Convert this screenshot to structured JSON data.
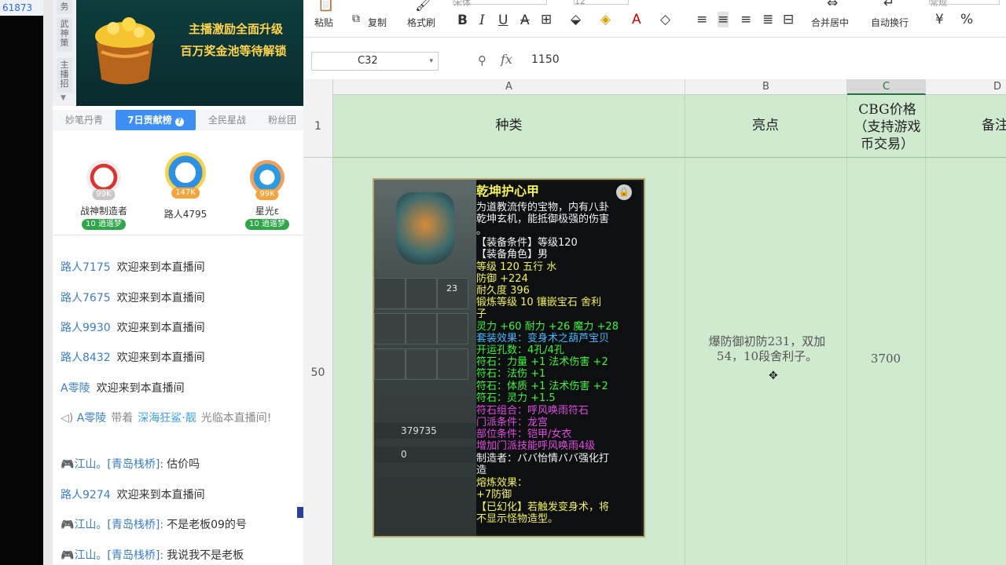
{
  "stream": {
    "user_id_tag": "61873",
    "side_tabs": [
      "务",
      "武神策",
      "主播招"
    ],
    "banner_line1": "主播激励全面升级",
    "banner_line2": "百万奖金池等待解锁",
    "tabs": [
      "妙笔丹青",
      "7日贡献榜",
      "全民星战",
      "粉丝团"
    ],
    "ranks": [
      {
        "name": "战神制造者",
        "score": "99K",
        "level": "10",
        "badge": "逍遥梦"
      },
      {
        "name": "路人4795",
        "score": "147K"
      },
      {
        "name": "星光ε",
        "score": "99K",
        "level": "10",
        "badge": "逍遥梦"
      }
    ],
    "chat": [
      {
        "user": "路人7175",
        "text": "欢迎来到本直播间"
      },
      {
        "user": "路人7675",
        "text": "欢迎来到本直播间"
      },
      {
        "user": "路人9930",
        "text": "欢迎来到本直播间"
      },
      {
        "user": "路人8432",
        "text": "欢迎来到本直播间"
      },
      {
        "user": "A零陵",
        "text": "欢迎来到本直播间"
      },
      {
        "user": "A零陵",
        "mid": "带着",
        "highlight": "深海狂鲨·靓",
        "text": "光临本直播间!"
      },
      {
        "user": "江山。[青岛栈桥]:",
        "text": "估价吗"
      },
      {
        "user": "路人9274",
        "text": "欢迎来到本直播间"
      },
      {
        "user": "江山。[青岛栈桥]:",
        "text": "不是老板09的号"
      },
      {
        "user": "江山。[青岛栈桥]:",
        "text": "我说我不是老板"
      }
    ]
  },
  "excel": {
    "ribbon": {
      "paste": "粘贴",
      "copy": "复制",
      "format_painter": "格式刷",
      "font": "宋体",
      "size": "12",
      "merge": "合并居中",
      "wrap": "自动换行",
      "currency": "¥",
      "percent": "%",
      "numfmt": "常规"
    },
    "namebox": "C32",
    "formula_value": "1150",
    "columns": [
      "A",
      "B",
      "C",
      "D"
    ],
    "rows": [
      "1",
      "50"
    ],
    "headers": {
      "a": "种类",
      "b": "亮点",
      "c": "CBG价格（支持游戏币交易）",
      "d": "备注"
    },
    "row50": {
      "highlight": "爆防御初防231，双加54，10段舍利子。",
      "price": "3700"
    }
  },
  "item": {
    "title": "乾坤护心甲",
    "desc1": "为道教流传的宝物，内有八卦",
    "desc2": "乾坤玄机，能抵御极强的伤害",
    "desc3": "。",
    "req1": "【装备条件】等级120",
    "req2": "【装备角色】男",
    "s1": "等级 120  五行 水",
    "s2": "防御 +224",
    "s3": "耐久度 396",
    "s4": "锻炼等级 10  镶嵌宝石 舍利",
    "s5": "子",
    "s6": "灵力 +60 耐力 +26 魔力 +28",
    "s7": "套装效果：变身术之葫芦宝贝",
    "s8": "开运孔数：4孔/4孔",
    "s9": "符石：力量 +1 法术伤害 +2",
    "s10": "符石：法伤 +1",
    "s11": "符石：体质 +1 法术伤害 +2",
    "s12": "符石：灵力 +1.5",
    "s13": "符石组合：呼风唤雨符石",
    "s14": "门派条件：龙宫",
    "s15": "部位条件：铠甲/女衣",
    "s16": "增加门派技能呼风唤雨4级",
    "s17": "制造者：ババ怡情ババ强化打",
    "s18": "造",
    "s19": "熔炼效果：",
    "s20": "+7防御",
    "s21": "【已幻化】若触发变身术，将",
    "s22": "不显示怪物造型。",
    "slot_number": "23",
    "gold_label": "金",
    "gold": "379735",
    "silver_label": "银",
    "silver": "0"
  }
}
